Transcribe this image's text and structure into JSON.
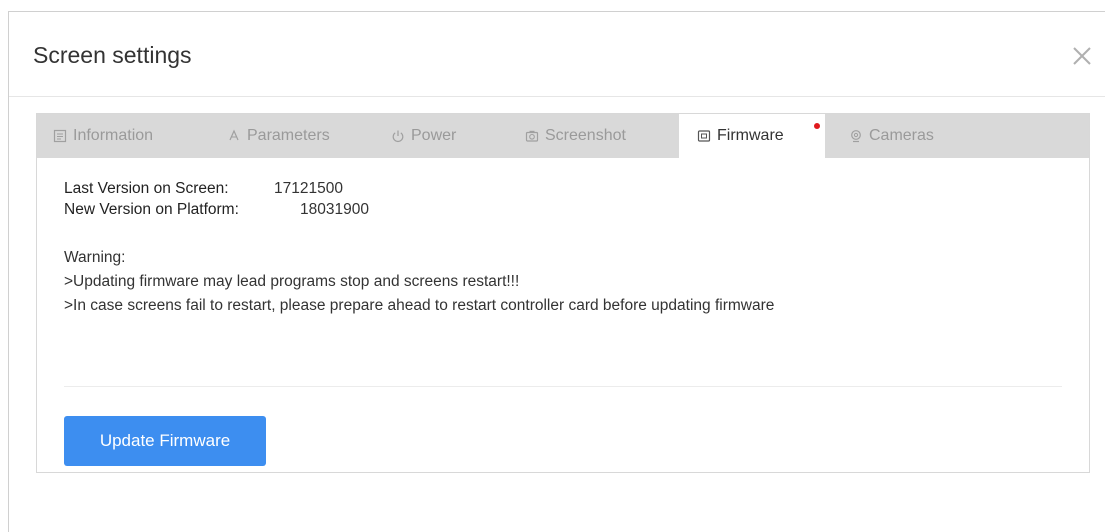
{
  "dialog": {
    "title": "Screen settings"
  },
  "tabs": [
    {
      "label": "Information",
      "icon": "document-icon",
      "active": false
    },
    {
      "label": "Parameters",
      "icon": "sliders-icon",
      "active": false
    },
    {
      "label": "Power",
      "icon": "power-icon",
      "active": false
    },
    {
      "label": "Screenshot",
      "icon": "camera-icon",
      "active": false
    },
    {
      "label": "Firmware",
      "icon": "chip-icon",
      "active": true,
      "badge": "red-dot"
    },
    {
      "label": "Cameras",
      "icon": "webcam-icon",
      "active": false
    }
  ],
  "firmware": {
    "last_version_label": "Last Version on Screen:",
    "last_version_value": "17121500",
    "new_version_label": "New Version on Platform:",
    "new_version_value": "18031900",
    "warning_title": "Warning:",
    "warning_line1": ">Updating firmware may lead programs stop and screens restart!!!",
    "warning_line2": ">In case screens fail to restart, please prepare ahead to restart controller card before updating firmware",
    "update_button": "Update Firmware"
  },
  "colors": {
    "accent": "#3d8ef0",
    "tabbar": "#d9d9d9",
    "badge": "#e0191d"
  }
}
